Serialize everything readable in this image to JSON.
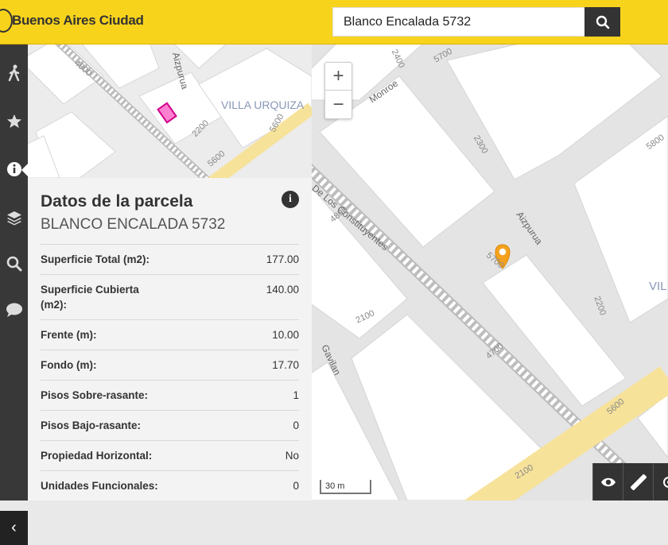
{
  "header": {
    "brand": "Buenos Aires Ciudad",
    "search_value": "Blanco Encalada 5732"
  },
  "sidebar": {
    "items": [
      {
        "icon": "walking-person-icon"
      },
      {
        "icon": "star-icon"
      },
      {
        "icon": "info-icon",
        "active": true
      },
      {
        "icon": "layers-icon"
      },
      {
        "icon": "search-icon"
      },
      {
        "icon": "chat-bubble-icon"
      }
    ],
    "collapse_label": "‹"
  },
  "minimap": {
    "street_labels": [
      "Aizpurua",
      "4800",
      "2200",
      "5600",
      "5600"
    ],
    "neighborhood": "VILLA URQUIZA"
  },
  "panel": {
    "title": "Datos de la parcela",
    "subtitle": "BLANCO ENCALADA 5732",
    "rows": [
      {
        "label": "Superficie Total (m2):",
        "value": "177.00"
      },
      {
        "label": "Superficie Cubierta (m2):",
        "value": "140.00"
      },
      {
        "label": "Frente (m):",
        "value": "10.00"
      },
      {
        "label": "Fondo (m):",
        "value": "17.70"
      },
      {
        "label": "Pisos Sobre-rasante:",
        "value": "1"
      },
      {
        "label": "Pisos Bajo-rasante:",
        "value": "0"
      },
      {
        "label": "Propiedad Horizontal:",
        "value": "No"
      },
      {
        "label": "Unidades Funcionales:",
        "value": "0"
      }
    ]
  },
  "map": {
    "zoom_in": "+",
    "zoom_out": "−",
    "scale": "30 m",
    "street_labels": [
      "De Los Constituyentes",
      "Monroe",
      "Aizpurua",
      "Gavilan",
      "2400",
      "5700",
      "2300",
      "5800",
      "4800",
      "2200",
      "2100",
      "4700",
      "5600",
      "2100",
      "5700"
    ],
    "neighborhood_partial": "VIL",
    "marker_color": "#f4a21e"
  }
}
